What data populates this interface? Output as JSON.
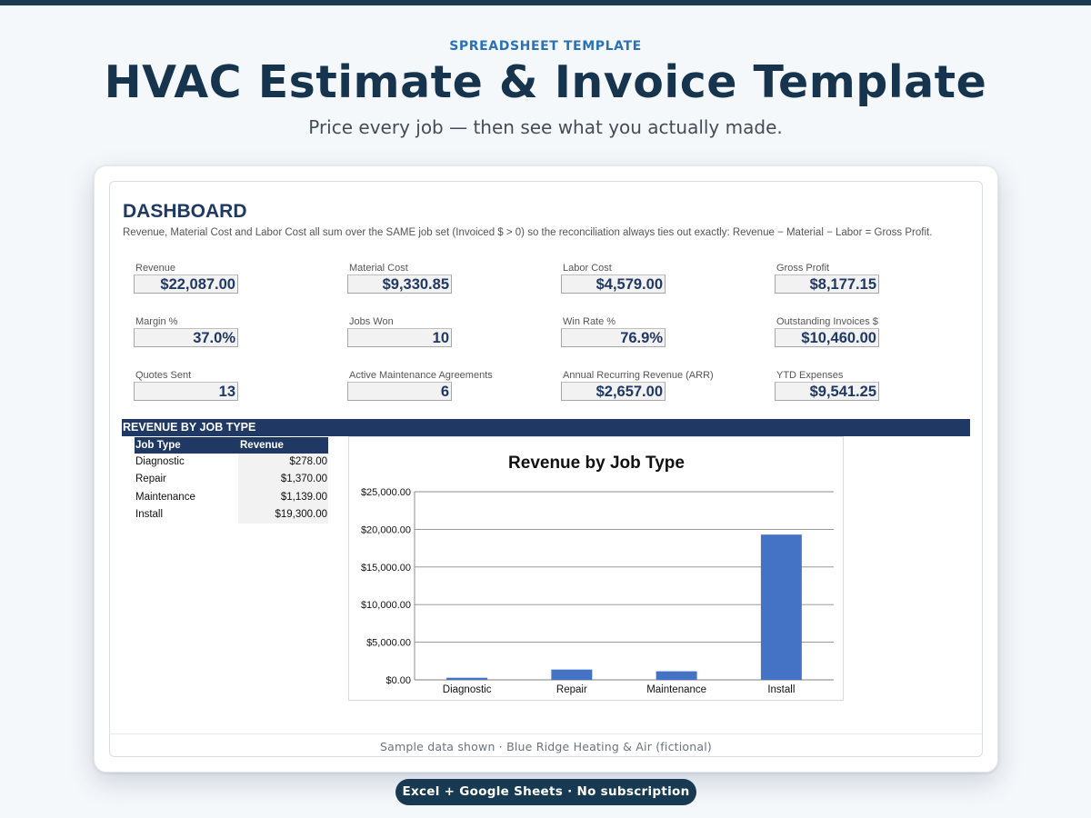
{
  "header": {
    "eyebrow": "SPREADSHEET TEMPLATE",
    "title": "HVAC Estimate & Invoice Template",
    "subtitle": "Price every job — then see what you actually made."
  },
  "dashboard": {
    "title": "DASHBOARD",
    "note": "Revenue, Material Cost and Labor Cost all sum over the SAME job set (Invoiced $ > 0) so the reconciliation always ties out exactly: Revenue − Material − Labor = Gross Profit.",
    "kpis": [
      {
        "label": "Revenue",
        "value": "$22,087.00"
      },
      {
        "label": "Material Cost",
        "value": "$9,330.85"
      },
      {
        "label": "Labor Cost",
        "value": "$4,579.00"
      },
      {
        "label": "Gross Profit",
        "value": "$8,177.15"
      },
      {
        "label": "Margin %",
        "value": "37.0%"
      },
      {
        "label": "Jobs Won",
        "value": "10"
      },
      {
        "label": "Win Rate %",
        "value": "76.9%"
      },
      {
        "label": "Outstanding Invoices $",
        "value": "$10,460.00"
      },
      {
        "label": "Quotes Sent",
        "value": "13"
      },
      {
        "label": "Active Maintenance Agreements",
        "value": "6"
      },
      {
        "label": "Annual Recurring Revenue (ARR)",
        "value": "$2,657.00"
      },
      {
        "label": "YTD Expenses",
        "value": "$9,541.25"
      }
    ]
  },
  "revenue_section": {
    "title": "REVENUE BY JOB TYPE",
    "table": {
      "headers": [
        "Job Type",
        "Revenue"
      ],
      "rows": [
        [
          "Diagnostic",
          "$278.00"
        ],
        [
          "Repair",
          "$1,370.00"
        ],
        [
          "Maintenance",
          "$1,139.00"
        ],
        [
          "Install",
          "$19,300.00"
        ]
      ]
    }
  },
  "chart_data": {
    "type": "bar",
    "title": "Revenue by Job Type",
    "categories": [
      "Diagnostic",
      "Repair",
      "Maintenance",
      "Install"
    ],
    "values": [
      278,
      1370,
      1139,
      19300
    ],
    "ylim": [
      0,
      25000
    ],
    "yticks": [
      "$0.00",
      "$5,000.00",
      "$10,000.00",
      "$15,000.00",
      "$20,000.00",
      "$25,000.00"
    ],
    "ytick_values": [
      0,
      5000,
      10000,
      15000,
      20000,
      25000
    ],
    "xlabel": "",
    "ylabel": "",
    "grid": true,
    "legend": "none",
    "bar_color": "#4472c4"
  },
  "footer": {
    "note": "Sample data shown · Blue Ridge Heating & Air (fictional)",
    "badge": "Excel + Google Sheets · No subscription"
  },
  "colors": {
    "accent": "#1f3864",
    "eyebrow": "#2a72b5",
    "hero": "#17344f"
  }
}
